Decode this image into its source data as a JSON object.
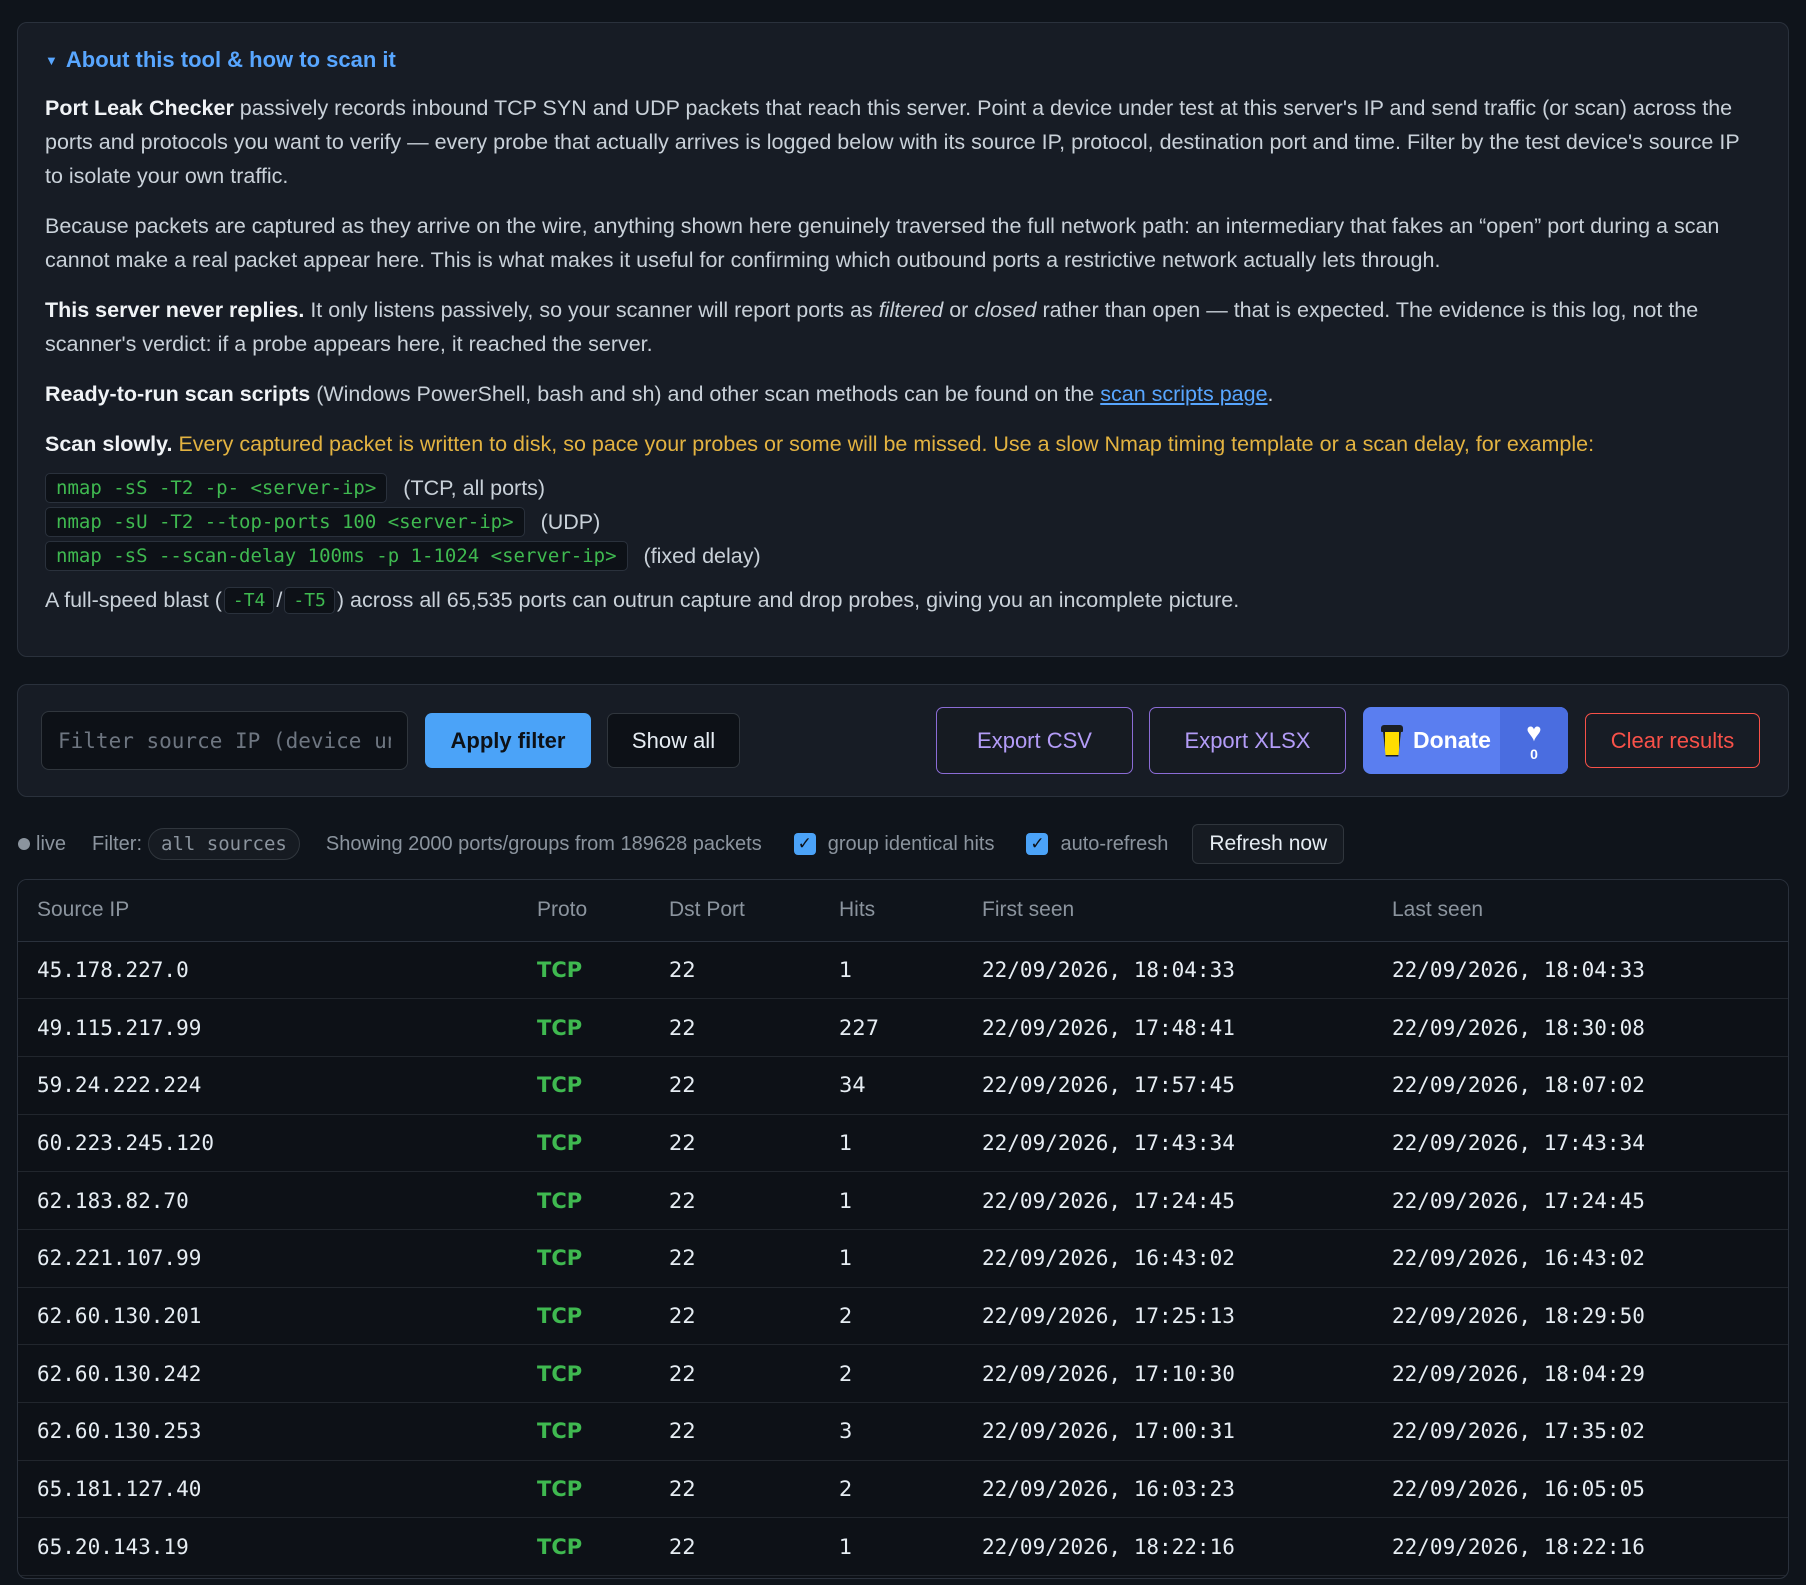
{
  "about": {
    "summary": "About this tool & how to scan it",
    "p1_bold": "Port Leak Checker",
    "p1_rest": " passively records inbound TCP SYN and UDP packets that reach this server. Point a device under test at this server's IP and send traffic (or scan) across the ports and protocols you want to verify — every probe that actually arrives is logged below with its source IP, protocol, destination port and time. Filter by the test device's source IP to isolate your own traffic.",
    "p2": "Because packets are captured as they arrive on the wire, anything shown here genuinely traversed the full network path: an intermediary that fakes an “open” port during a scan cannot make a real packet appear here. This is what makes it useful for confirming which outbound ports a restrictive network actually lets through.",
    "p3_bold": "This server never replies.",
    "p3_a": " It only listens passively, so your scanner will report ports as ",
    "p3_filtered": "filtered",
    "p3_or": " or ",
    "p3_closed": "closed",
    "p3_b": " rather than open — that is expected. The evidence is this log, not the scanner's verdict: if a probe appears here, it reached the server.",
    "p4_bold": "Ready-to-run scan scripts",
    "p4_a": " (Windows PowerShell, bash and sh) and other scan methods can be found on the ",
    "p4_link": "scan scripts page",
    "p4_end": ".",
    "p5_bold": "Scan slowly.",
    "p5_warn": " Every captured packet is written to disk, so pace your probes or some will be missed. Use a slow Nmap timing template or a scan delay, for example:",
    "commands": [
      {
        "code": "nmap -sS -T2 -p- <server-ip>",
        "note": "(TCP, all ports)"
      },
      {
        "code": "nmap -sU -T2 --top-ports 100 <server-ip>",
        "note": "(UDP)"
      },
      {
        "code": "nmap -sS --scan-delay 100ms -p 1-1024 <server-ip>",
        "note": "(fixed delay)"
      }
    ],
    "last_a": "A full-speed blast (",
    "last_t4": "-T4",
    "last_slash": "/",
    "last_t5": "-T5",
    "last_b": ") across all 65,535 ports can outrun capture and drop probes, giving you an incomplete picture."
  },
  "toolbar": {
    "filter_placeholder": "Filter source IP (device under test)",
    "filter_value": "",
    "apply": "Apply filter",
    "show_all": "Show all",
    "export_csv": "Export CSV",
    "export_xlsx": "Export XLSX",
    "donate": "Donate",
    "donate_count": "0",
    "clear": "Clear results"
  },
  "status": {
    "live": "live",
    "filter_label": "Filter:",
    "filter_value": "all sources",
    "showing": "Showing 2000 ports/groups from 189628 packets",
    "group_identical": "group identical hits",
    "auto_refresh": "auto-refresh",
    "refresh_now": "Refresh now"
  },
  "table": {
    "headers": [
      "Source IP",
      "Proto",
      "Dst Port",
      "Hits",
      "First seen",
      "Last seen"
    ],
    "rows": [
      [
        "45.178.227.0",
        "TCP",
        "22",
        "1",
        "22/09/2026, 18:04:33",
        "22/09/2026, 18:04:33"
      ],
      [
        "49.115.217.99",
        "TCP",
        "22",
        "227",
        "22/09/2026, 17:48:41",
        "22/09/2026, 18:30:08"
      ],
      [
        "59.24.222.224",
        "TCP",
        "22",
        "34",
        "22/09/2026, 17:57:45",
        "22/09/2026, 18:07:02"
      ],
      [
        "60.223.245.120",
        "TCP",
        "22",
        "1",
        "22/09/2026, 17:43:34",
        "22/09/2026, 17:43:34"
      ],
      [
        "62.183.82.70",
        "TCP",
        "22",
        "1",
        "22/09/2026, 17:24:45",
        "22/09/2026, 17:24:45"
      ],
      [
        "62.221.107.99",
        "TCP",
        "22",
        "1",
        "22/09/2026, 16:43:02",
        "22/09/2026, 16:43:02"
      ],
      [
        "62.60.130.201",
        "TCP",
        "22",
        "2",
        "22/09/2026, 17:25:13",
        "22/09/2026, 18:29:50"
      ],
      [
        "62.60.130.242",
        "TCP",
        "22",
        "2",
        "22/09/2026, 17:10:30",
        "22/09/2026, 18:04:29"
      ],
      [
        "62.60.130.253",
        "TCP",
        "22",
        "3",
        "22/09/2026, 17:00:31",
        "22/09/2026, 17:35:02"
      ],
      [
        "65.181.127.40",
        "TCP",
        "22",
        "2",
        "22/09/2026, 16:03:23",
        "22/09/2026, 16:05:05"
      ],
      [
        "65.20.143.19",
        "TCP",
        "22",
        "1",
        "22/09/2026, 18:22:16",
        "22/09/2026, 18:22:16"
      ]
    ]
  },
  "colors": {
    "accent": "#58a6ff",
    "proto": "#3fb950",
    "warn": "#e3b341",
    "danger": "#f85149",
    "export": "#8b6cd6",
    "donate": "#5a7ef0"
  },
  "icons": {
    "summary": "triangle-down-icon",
    "live": "status-dot-icon",
    "donate": "coffee-cup-icon",
    "heart": "heart-icon",
    "checkbox": "check-icon"
  }
}
